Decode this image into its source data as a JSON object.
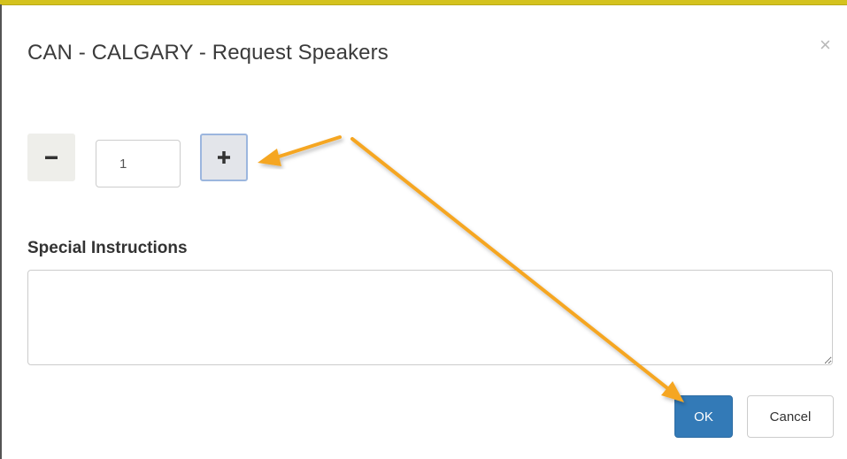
{
  "modal": {
    "title": "CAN - CALGARY - Request Speakers",
    "close_symbol": "×"
  },
  "stepper": {
    "minus_label": "−",
    "plus_label": "+",
    "value": "1"
  },
  "instructions": {
    "label": "Special Instructions",
    "value": ""
  },
  "buttons": {
    "ok_label": "OK",
    "cancel_label": "Cancel"
  },
  "annotation": {
    "arrow_color": "#f5a623"
  },
  "colors": {
    "accent_bar": "#d4c21e",
    "primary_button": "#337ab7"
  }
}
